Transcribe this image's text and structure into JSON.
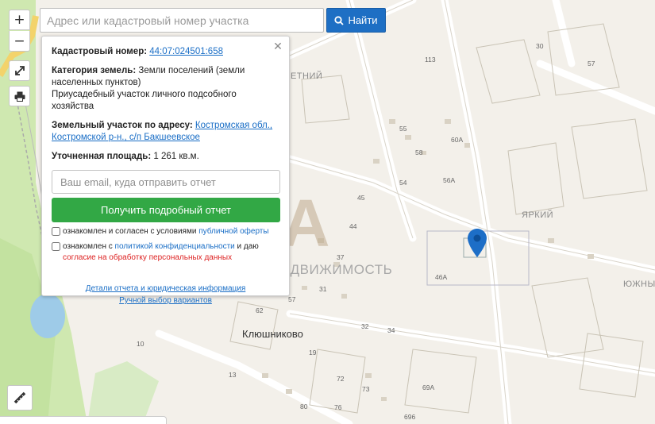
{
  "search": {
    "placeholder": "Адрес или кадастровый номер участка",
    "button_label": "Найти"
  },
  "controls": {
    "zoom_in": "+",
    "zoom_out": "−"
  },
  "popup": {
    "close_label": "✕",
    "cadastral_label": "Кадастровый номер:",
    "cadastral_value": "44:07:024501:658",
    "category_label": "Категория земель:",
    "category_value": "Земли поселений (земли населенных пунктов)",
    "usage_value": "Приусадебный участок личного подсобного хозяйства",
    "address_label": "Земельный участок по адресу:",
    "address_value": "Костромская обл., Костромской р-н., с/п Бакшеевское",
    "area_label": "Уточненная площадь:",
    "area_value": "1 261 кв.м.",
    "email_placeholder": "Ваш email, куда отправить отчет",
    "get_button": "Получить подробный отчет",
    "consent1_text": "ознакомлен и согласен с условиями",
    "consent1_link": "публичной оферты",
    "consent2_text": "ознакомлен с",
    "consent2_link": "политикой конфиденциальности",
    "consent2_and": "и даю",
    "consent2_red": "согласие на обработку персональных данных",
    "details_link": "Детали отчета и юридическая информация",
    "manual_link": "Ручной выбор вариантов"
  },
  "map": {
    "village": "Клюшниково",
    "areas": [
      "ЕТНИЙ",
      "ЯРКИЙ",
      "ЮЖНЫ"
    ],
    "house_numbers": [
      "113",
      "30",
      "57",
      "55",
      "58",
      "60A",
      "54",
      "56A",
      "45",
      "44",
      "37",
      "46A",
      "31",
      "57",
      "62",
      "32",
      "34",
      "10",
      "19",
      "13",
      "72",
      "73",
      "69A",
      "80",
      "76",
      "696"
    ]
  },
  "watermark": {
    "logo": "ДОНА",
    "subtitle": "НЕДВИЖИМОСТЬ"
  },
  "colors": {
    "accent_blue": "#1e6fc4",
    "green_button": "#32a845",
    "pin": "#1d6ec7"
  }
}
